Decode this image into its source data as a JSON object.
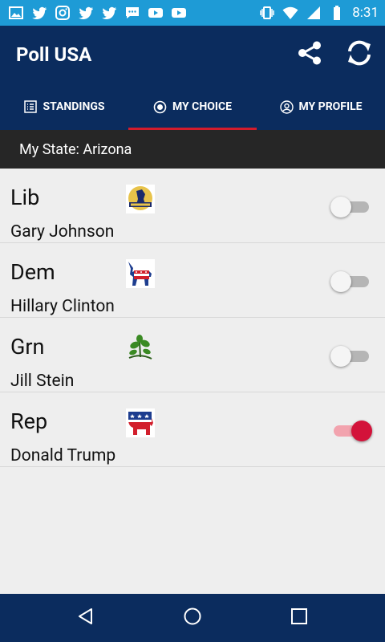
{
  "status_bar": {
    "time": "8:31",
    "left_icons": [
      "image-icon",
      "twitter-icon",
      "instagram-icon",
      "twitter-icon",
      "twitter-icon",
      "chat-icon",
      "youtube-icon",
      "youtube-icon"
    ],
    "right_icons": [
      "vibrate-icon",
      "wifi-icon",
      "signal-icon",
      "battery-icon"
    ]
  },
  "app_bar": {
    "title": "Poll USA",
    "actions": [
      "share-icon",
      "refresh-icon"
    ]
  },
  "tabs": [
    {
      "label": "STANDINGS",
      "icon": "list-icon",
      "active": false
    },
    {
      "label": "MY CHOICE",
      "icon": "radio-icon",
      "active": true
    },
    {
      "label": "MY PROFILE",
      "icon": "profile-icon",
      "active": false
    }
  ],
  "state_bar": {
    "label": "My State: Arizona"
  },
  "candidates": [
    {
      "party": "Lib",
      "name": "Gary Johnson",
      "logo": "libertarian-logo-icon",
      "selected": false
    },
    {
      "party": "Dem",
      "name": "Hillary Clinton",
      "logo": "democrat-donkey-icon",
      "selected": false
    },
    {
      "party": "Grn",
      "name": "Jill Stein",
      "logo": "green-party-icon",
      "selected": false
    },
    {
      "party": "Rep",
      "name": "Donald Trump",
      "logo": "republican-elephant-icon",
      "selected": true
    }
  ],
  "nav_bar": {
    "buttons": [
      "back-icon",
      "home-icon",
      "recents-icon"
    ]
  },
  "colors": {
    "status_bar": "#1e9bd6",
    "primary": "#0b2c5e",
    "tab_indicator": "#d31c2c",
    "state_bar": "#262626",
    "toggle_on": "#d3123a"
  }
}
